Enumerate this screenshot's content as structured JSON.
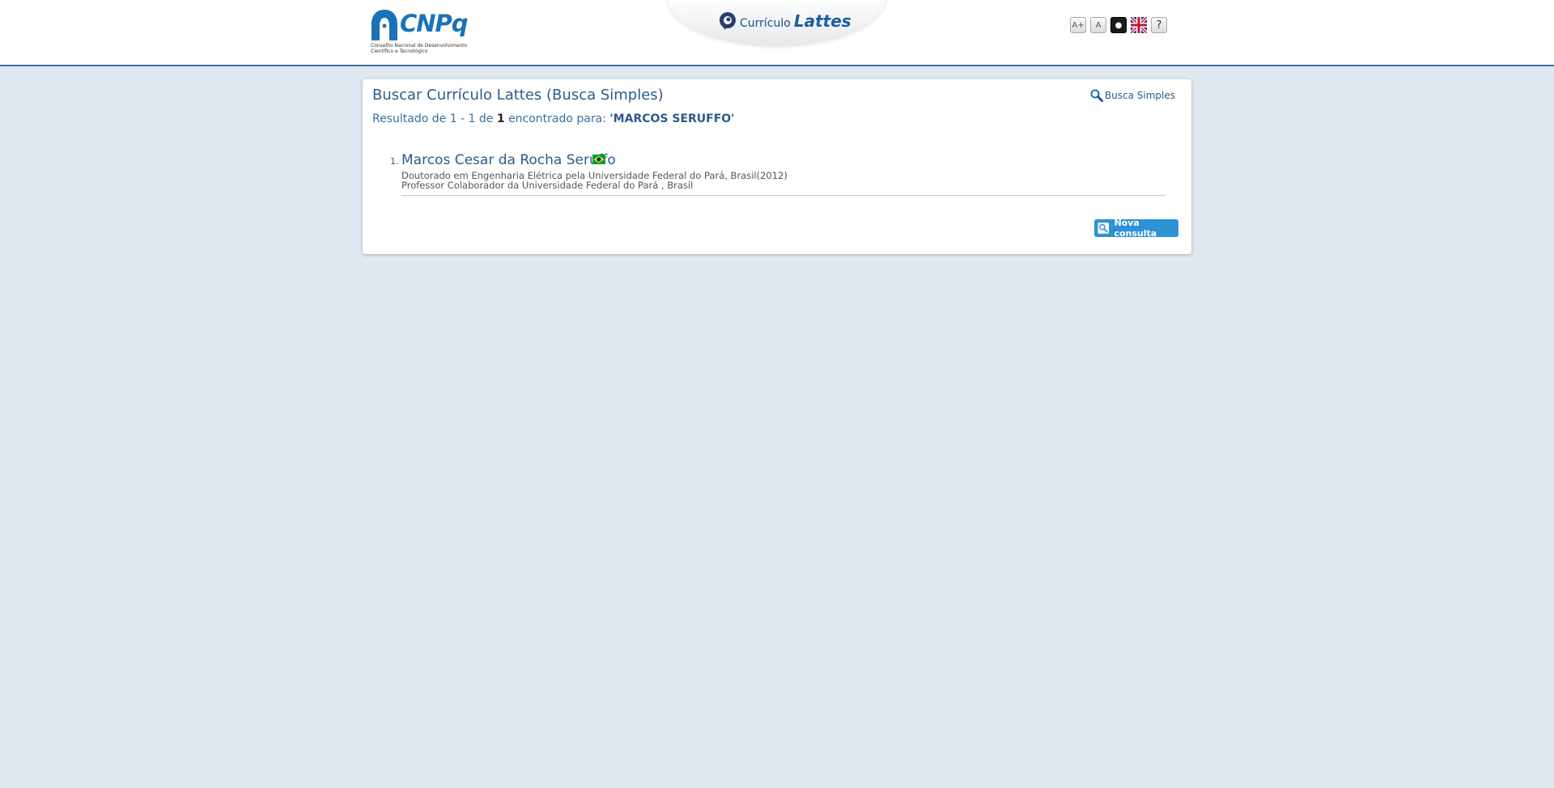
{
  "header": {
    "logo_text": "CNPq",
    "logo_subtitle": "Conselho Nacional de Desenvolvimento Científico e Tecnológico",
    "app_prefix": "Currículo",
    "app_name": "Lattes",
    "tools": [
      {
        "icon": "font-increase-icon",
        "label": "A+"
      },
      {
        "icon": "font-normal-icon",
        "label": "A"
      },
      {
        "icon": "high-contrast-icon",
        "label": "●"
      },
      {
        "icon": "uk-flag-icon",
        "label": ""
      },
      {
        "icon": "help-icon",
        "label": "?"
      }
    ]
  },
  "search": {
    "title": "Buscar Currículo Lattes (Busca Simples)",
    "mode_link": "Busca Simples",
    "result_prefix": "Resultado de 1 - 1 de",
    "result_total": "1",
    "result_mid": "encontrado para:",
    "query": "'MARCOS SERUFFO'"
  },
  "results": [
    {
      "number": "1.",
      "name": "Marcos Cesar da Rocha Seruffo",
      "country_flag": "brazil-flag-icon",
      "degree": "Doutorado em Engenharia Elétrica pela Universidade Federal do Pará, Brasil(2012)",
      "position": "Professor Colaborador da Universidade Federal do Pará , Brasil"
    }
  ],
  "actions": {
    "new_search": "Nova consulta"
  },
  "colors": {
    "background": "#e1e8f1",
    "accent": "#2c5b8a",
    "button": "#2f91d6",
    "header_rule": "#3a6ea5"
  }
}
